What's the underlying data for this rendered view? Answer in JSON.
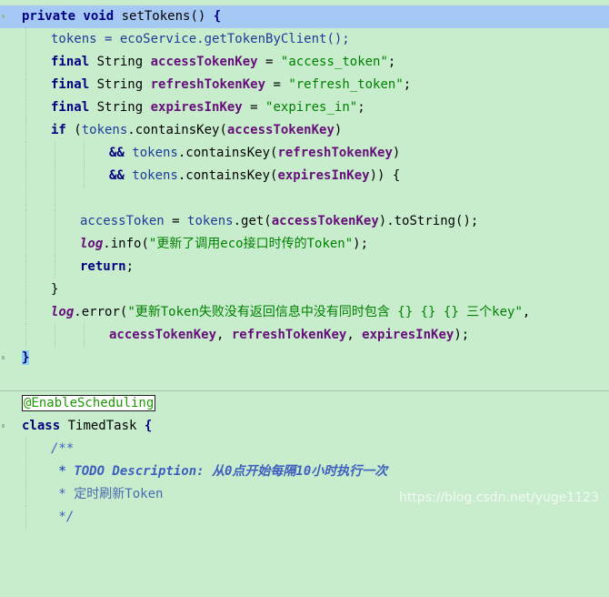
{
  "code": {
    "l1": {
      "kw": "private void",
      "name": "setTokens()",
      "brace": "{"
    },
    "l2": {
      "var": "tokens",
      "rest": " = ecoService.getTokenByClient();"
    },
    "l3": {
      "kw": "final",
      "type": " String ",
      "var": "accessTokenKey",
      "eq": " = ",
      "str": "\"access_token\"",
      "end": ";"
    },
    "l4": {
      "kw": "final",
      "type": " String ",
      "var": "refreshTokenKey",
      "eq": " = ",
      "str": "\"refresh_token\"",
      "end": ";"
    },
    "l5": {
      "kw": "final",
      "type": " String ",
      "var": "expiresInKey",
      "eq": " = ",
      "str": "\"expires_in\"",
      "end": ";"
    },
    "l6": {
      "kw": "if",
      "p1": " (",
      "var": "tokens",
      "m": ".containsKey(",
      "arg": "accessTokenKey",
      "end": ")"
    },
    "l7": {
      "op": "&&",
      "var": " tokens",
      "m": ".containsKey(",
      "arg": "refreshTokenKey",
      "end": ")"
    },
    "l8": {
      "op": "&&",
      "var": " tokens",
      "m": ".containsKey(",
      "arg": "expiresInKey",
      "end": ")) {"
    },
    "l10": {
      "var": "accessToken",
      "eq": " = ",
      "var2": "tokens",
      "m": ".get(",
      "arg": "accessTokenKey",
      "end": ").toString();"
    },
    "l11": {
      "log": "log",
      "m": ".info(",
      "str": "\"更新了调用eco接口时传的Token\"",
      "end": ");"
    },
    "l12": {
      "kw": "return",
      "end": ";"
    },
    "l13": {
      "brace": "}"
    },
    "l14": {
      "log": "log",
      "m": ".error(",
      "str": "\"更新Token失败没有返回信息中没有同时包含 {} {} {} 三个key\"",
      "end": ","
    },
    "l15": {
      "a1": "accessTokenKey",
      "c1": ", ",
      "a2": "refreshTokenKey",
      "c2": ", ",
      "a3": "expiresInKey",
      "end": ");"
    },
    "l16": {
      "brace": "}"
    },
    "l18": {
      "ann": "@EnableScheduling"
    },
    "l19": {
      "kw": "class",
      "name": " TimedTask ",
      "brace": "{"
    },
    "l20": {
      "cmt": "/**"
    },
    "l21": {
      "cmt": " * TODO Description: 从0点开始每隔10小时执行一次"
    },
    "l22": {
      "star": " * ",
      "cmt": "定时刷新Token"
    },
    "l23": {
      "cmt": " */"
    }
  },
  "watermark": "https://blog.csdn.net/yuge1123"
}
